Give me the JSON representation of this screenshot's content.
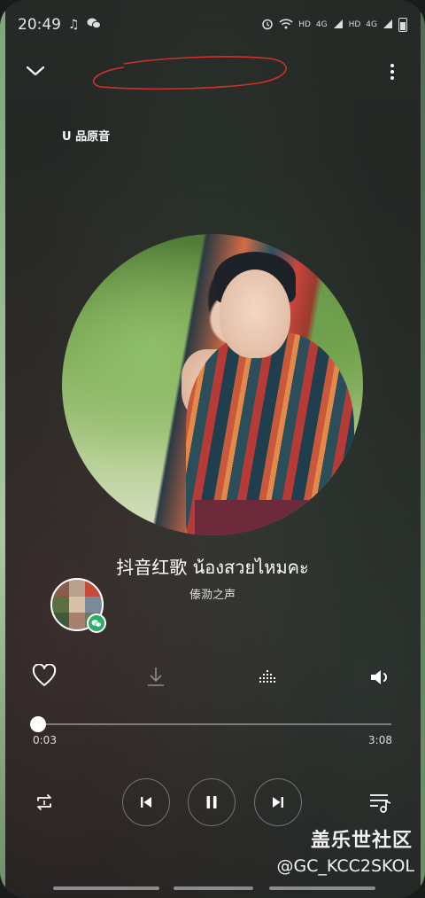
{
  "status_bar": {
    "time": "20:49",
    "indicators": [
      "HD",
      "4G",
      "HD",
      "4G"
    ],
    "icons": [
      "tiktok-icon",
      "wechat-icon",
      "alarm-icon",
      "wifi-icon",
      "signal-icon",
      "battery-icon"
    ]
  },
  "top_bar": {
    "collapse_icon": "chevron-down-icon",
    "more_icon": "more-vertical-icon"
  },
  "quality_label": "U 品原音",
  "song": {
    "title": "抖音红歌 น้องสวยไหมคะ",
    "artist": "傣泐之声"
  },
  "actions": [
    "heart-icon",
    "download-icon",
    "sound-effect-icon",
    "volume-icon"
  ],
  "progress": {
    "current": "0:03",
    "total": "3:08",
    "fraction": 0.016
  },
  "controls": [
    "repeat-icon",
    "previous-icon",
    "pause-icon",
    "next-icon",
    "playlist-icon"
  ],
  "watermark": {
    "site": "盖乐世社区",
    "handle": "@GC_KCC2SKOL"
  },
  "colors": {
    "accent_green": "#2aae67",
    "scribble_red": "#d0312d"
  }
}
